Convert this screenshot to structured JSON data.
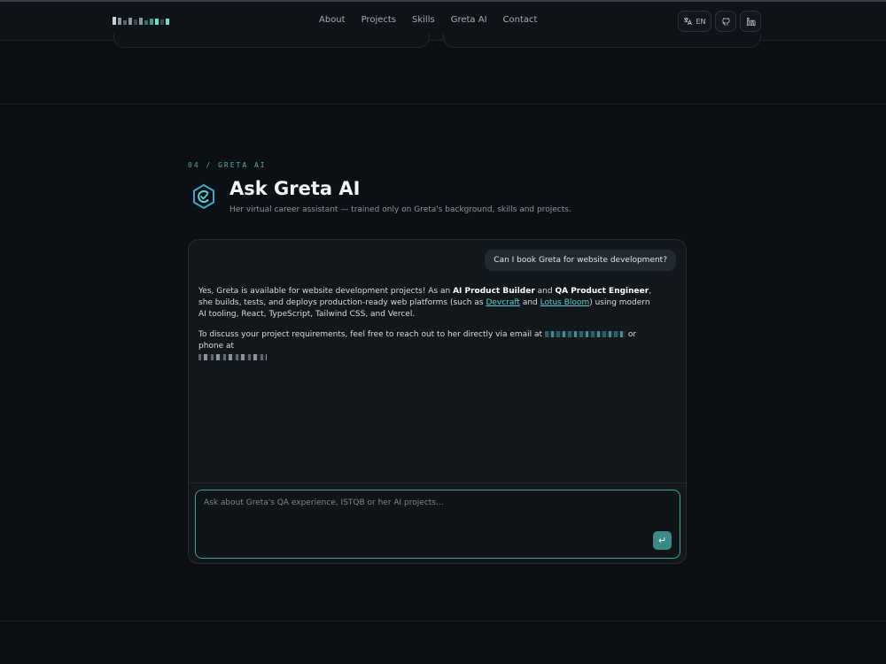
{
  "header": {
    "nav": [
      "About",
      "Projects",
      "Skills",
      "Greta AI",
      "Contact"
    ],
    "lang_label": "EN",
    "icons": [
      "translate-icon",
      "github-icon",
      "linkedin-icon"
    ]
  },
  "section": {
    "label": "04 / GRETA AI",
    "title": "Ask Greta AI",
    "subtitle": "Her virtual career assistant — trained only on Greta's background, skills and projects."
  },
  "chat": {
    "user_message": "Can I book Greta for website development?",
    "bot": {
      "p1_a": "Yes, Greta is available for website development projects! As an ",
      "p1_b1": "AI Product Builder",
      "p1_c": " and ",
      "p1_b2": "QA Product Engineer",
      "p1_d": ", she builds, tests, and deploys production-ready web platforms (such as ",
      "link1": "Devcraft",
      "p1_e": " and ",
      "link2": "Lotus Bloom",
      "p1_f": ") using modern AI tooling, React, TypeScript, Tailwind CSS, and Vercel.",
      "p2_a": "To discuss your project requirements, feel free to reach out to her directly via email at ",
      "p2_b": " or phone at "
    },
    "input_placeholder": "Ask about Greta's QA experience, ISTQB or her AI projects...",
    "send_icon": "return-arrow-icon"
  },
  "colors": {
    "accent": "#3fa59a",
    "link": "#5fcfd0",
    "background": "#0c1014"
  }
}
